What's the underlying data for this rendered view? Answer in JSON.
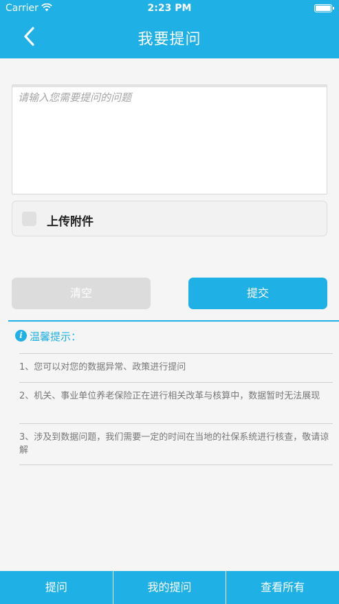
{
  "statusbar": {
    "carrier": "Carrier",
    "time": "2:23 PM",
    "icons": [
      "wifi-icon",
      "battery-icon"
    ]
  },
  "header": {
    "title": "我要提问",
    "back_icon": "chevron-left-icon"
  },
  "form": {
    "question_placeholder": "请输入您需要提问的问题",
    "question_value": "",
    "attach_label": "上传附件",
    "attach_checked": false,
    "clear_label": "清空",
    "submit_label": "提交"
  },
  "tips": {
    "icon": "info-icon",
    "icon_glyph": "i",
    "title": "温馨提示：",
    "items": [
      "1、您可以对您的数据异常、政策进行提问",
      "2、机关、事业单位养老保险正在进行相关改革与核算中，数据暂时无法展现",
      "3、涉及到数据问题，我们需要一定的时间在当地的社保系统进行核查，敬请谅解"
    ]
  },
  "tabbar": {
    "items": [
      {
        "label": "提问"
      },
      {
        "label": "我的提问"
      },
      {
        "label": "查看所有"
      }
    ]
  },
  "colors": {
    "accent": "#1fb0e6",
    "disabled_button": "#dcdcdc",
    "background": "#f5f5f5"
  }
}
